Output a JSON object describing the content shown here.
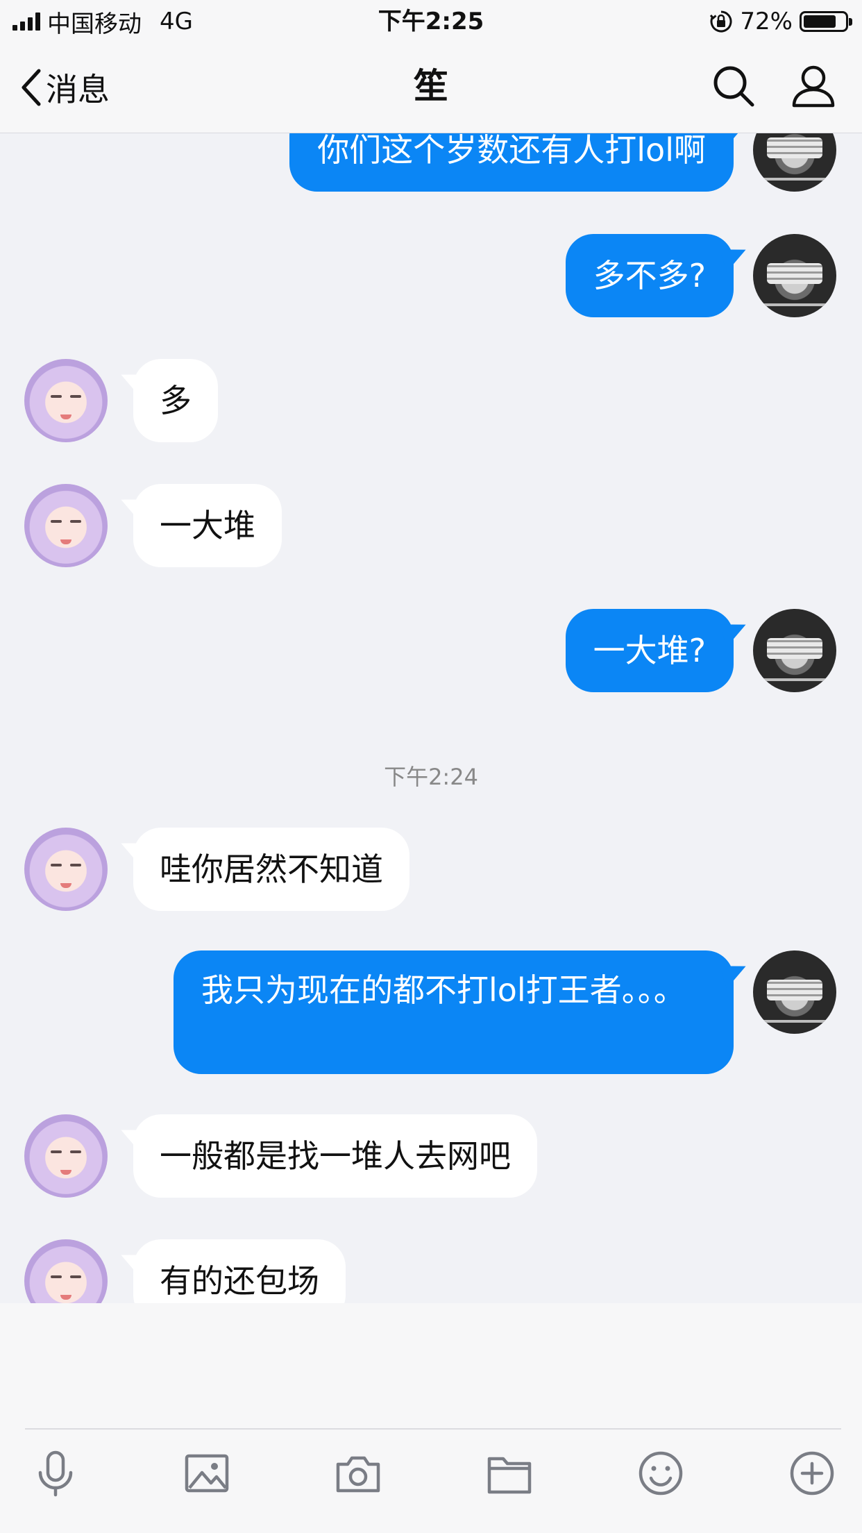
{
  "status_bar": {
    "carrier": "中国移动",
    "network": "4G",
    "time": "下午2:25",
    "battery": "72%"
  },
  "nav": {
    "back_label": "消息",
    "title": "笙"
  },
  "chat": {
    "messages": [
      {
        "from": "me",
        "text": "你们这个岁数还有人打lol啊"
      },
      {
        "from": "me",
        "text": "多不多?"
      },
      {
        "from": "them",
        "text": "多"
      },
      {
        "from": "them",
        "text": "一大堆"
      },
      {
        "from": "me",
        "text": "一大堆?"
      },
      {
        "from": "them",
        "text": "哇你居然不知道"
      },
      {
        "from": "me",
        "text": "我只为现在的都不打lol打王者。。。"
      },
      {
        "from": "them",
        "text": "一般都是找一堆人去网吧"
      },
      {
        "from": "them",
        "text": "有的还包场"
      }
    ],
    "timestamp": "下午2:24"
  },
  "toolbar": {
    "icons": [
      "microphone-icon",
      "image-icon",
      "camera-icon",
      "folder-icon",
      "emoji-icon",
      "plus-icon"
    ]
  },
  "colors": {
    "outgoing_bubble": "#0b86f5",
    "incoming_bubble": "#ffffff",
    "background": "#f1f2f6"
  }
}
